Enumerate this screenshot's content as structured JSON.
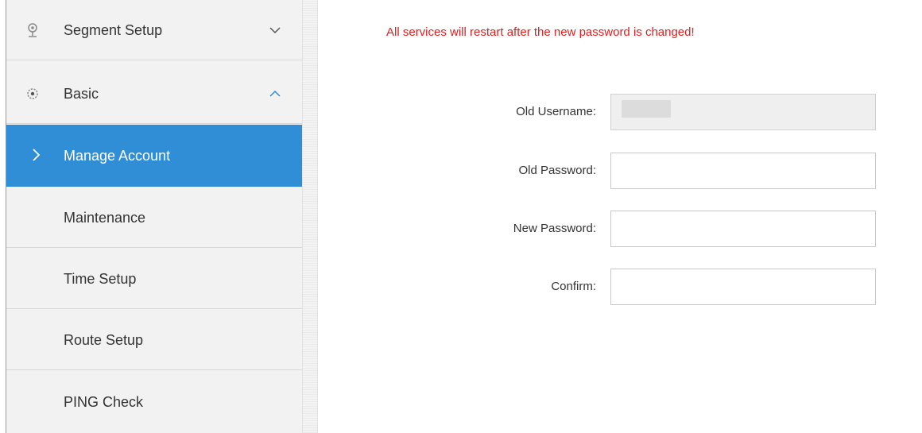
{
  "sidebar": {
    "items": [
      {
        "label": "Segment Setup",
        "icon": "segment-icon",
        "chevron": "chevron-down-icon"
      },
      {
        "label": "Basic",
        "icon": "gear-icon",
        "chevron": "chevron-up-icon"
      },
      {
        "label": "Manage Account",
        "active": true,
        "indicator": "chevron-right-icon"
      },
      {
        "label": "Maintenance"
      },
      {
        "label": "Time Setup"
      },
      {
        "label": "Route Setup"
      },
      {
        "label": "PING Check"
      }
    ]
  },
  "main": {
    "warning": "All services will restart after the new password is changed!",
    "form": {
      "old_username_label": "Old Username:",
      "old_username_value": "",
      "old_password_label": "Old Password:",
      "old_password_value": "",
      "new_password_label": "New Password:",
      "new_password_value": "",
      "confirm_label": "Confirm:",
      "confirm_value": ""
    }
  },
  "colors": {
    "accent": "#2f8ed6",
    "warning": "#e31e1e",
    "sidebar_bg": "#f2f2f2"
  }
}
